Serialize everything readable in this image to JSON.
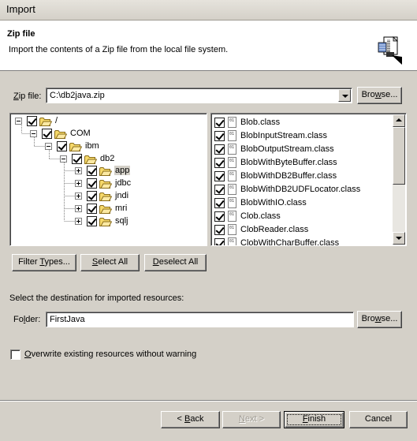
{
  "window": {
    "title": "Import"
  },
  "banner": {
    "heading": "Zip file",
    "description": "Import the contents of a Zip file from the local file system."
  },
  "zip": {
    "label_key": "Z",
    "label_rest": "ip file:",
    "value": "C:\\db2java.zip",
    "browse_key": "w",
    "browse_pre": "Bro",
    "browse_post": "se..."
  },
  "tree": {
    "items": [
      {
        "label": "/",
        "expanded": true,
        "checked": true
      },
      {
        "label": "COM",
        "expanded": true,
        "checked": true
      },
      {
        "label": "ibm",
        "expanded": true,
        "checked": true
      },
      {
        "label": "db2",
        "expanded": true,
        "checked": true
      },
      {
        "label": "app",
        "expanded": false,
        "checked": true,
        "selected": true
      },
      {
        "label": "jdbc",
        "expanded": false,
        "checked": true
      },
      {
        "label": "jndi",
        "expanded": false,
        "checked": true
      },
      {
        "label": "mri",
        "expanded": false,
        "checked": true
      },
      {
        "label": "sqlj",
        "expanded": false,
        "checked": true
      }
    ]
  },
  "files": [
    {
      "name": "Blob.class",
      "checked": true
    },
    {
      "name": "BlobInputStream.class",
      "checked": true
    },
    {
      "name": "BlobOutputStream.class",
      "checked": true
    },
    {
      "name": "BlobWithByteBuffer.class",
      "checked": true
    },
    {
      "name": "BlobWithDB2Buffer.class",
      "checked": true
    },
    {
      "name": "BlobWithDB2UDFLocator.class",
      "checked": true
    },
    {
      "name": "BlobWithIO.class",
      "checked": true
    },
    {
      "name": "Clob.class",
      "checked": true
    },
    {
      "name": "ClobReader.class",
      "checked": true
    },
    {
      "name": "ClobWithCharBuffer.class",
      "checked": true
    }
  ],
  "selection_buttons": {
    "filter_pre": "Filter ",
    "filter_key": "T",
    "filter_post": "ypes...",
    "select_all_key": "S",
    "select_all_rest": "elect All",
    "deselect_all_key": "D",
    "deselect_all_rest": "eselect All"
  },
  "destination": {
    "prompt": "Select the destination for imported resources:",
    "folder_label_pre": "Fo",
    "folder_label_key": "l",
    "folder_label_post": "der:",
    "folder_value": "FirstJava",
    "browse_key": "w",
    "browse_pre": "Bro",
    "browse_post": "se..."
  },
  "options": {
    "overwrite_key": "O",
    "overwrite_rest": "verwrite existing resources without warning",
    "overwrite_checked": false
  },
  "footer": {
    "back_pre": "< ",
    "back_key": "B",
    "back_post": "ack",
    "next_key": "N",
    "next_post": "ext >",
    "finish_key": "F",
    "finish_post": "inish",
    "cancel": "Cancel"
  },
  "colors": {
    "dialog_bg": "#d4d0c8",
    "banner_bg": "#ffffff",
    "folder_yellow": "#f6d96b"
  }
}
